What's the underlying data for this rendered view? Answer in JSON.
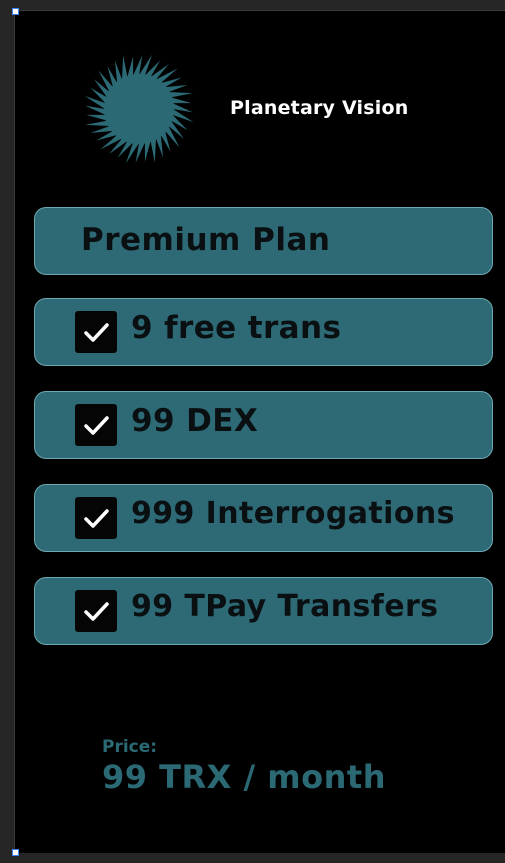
{
  "brand": {
    "name": "Planetary Vision",
    "logo_icon": "sun-icon",
    "logo_color": "#2b6a75"
  },
  "plan": {
    "title": "Premium Plan",
    "features": [
      {
        "label": "9 free trans",
        "checked": true
      },
      {
        "label": "99 DEX",
        "checked": true
      },
      {
        "label": "999 Interrogations",
        "checked": true
      },
      {
        "label": "99 TPay Transfers",
        "checked": true
      }
    ]
  },
  "price": {
    "label": "Price:",
    "value": "99 TRX / month"
  },
  "colors": {
    "accent": "#2e6a75",
    "accent_border": "#6ea9b3",
    "background": "#000000",
    "text_dark": "#0a0f11"
  }
}
